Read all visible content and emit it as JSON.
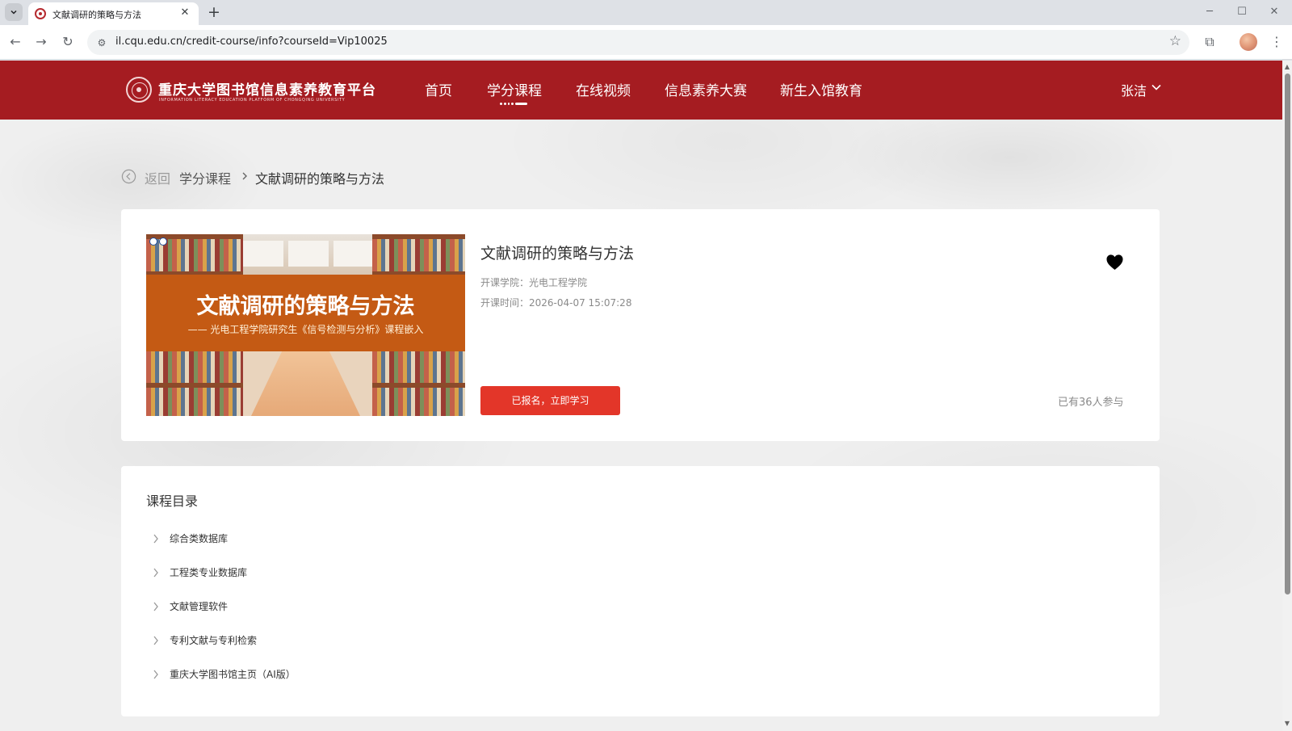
{
  "browser": {
    "tab_title": "文献调研的策略与方法",
    "url": "il.cqu.edu.cn/credit-course/info?courseId=Vip10025",
    "new_tab_label": "+",
    "close_label": "✕"
  },
  "header": {
    "logo_cn": "重庆大学图书馆信息素养教育平台",
    "logo_en": "INFORMATION LITERACY EDUCATION PLATFORM OF CHONGQING UNIVERSITY",
    "nav": [
      {
        "label": "首页"
      },
      {
        "label": "学分课程"
      },
      {
        "label": "在线视频"
      },
      {
        "label": "信息素养大赛"
      },
      {
        "label": "新生入馆教育"
      }
    ],
    "active_nav": "学分课程",
    "user_name": "张洁"
  },
  "breadcrumb": {
    "back": "返回",
    "parent": "学分课程",
    "current": "文献调研的策略与方法"
  },
  "course": {
    "cover_title": "文献调研的策略与方法",
    "cover_subtitle": "—— 光电工程学院研究生《信号检测与分析》课程嵌入",
    "title": "文献调研的策略与方法",
    "college": "开课学院：光电工程学院",
    "start_time": "开课时间：2026-04-07 15:07:28",
    "enroll_button": "已报名，立即学习",
    "participants": "已有36人参与"
  },
  "catalog": {
    "title": "课程目录",
    "items": [
      {
        "label": "综合类数据库"
      },
      {
        "label": "工程类专业数据库"
      },
      {
        "label": "文献管理软件"
      },
      {
        "label": "专利文献与专利检索"
      },
      {
        "label": "重庆大学图书馆主页（AI版）"
      }
    ]
  },
  "colors": {
    "brand_red": "#a51c21",
    "button_red": "#e33629",
    "cover_band": "#c45a14"
  }
}
